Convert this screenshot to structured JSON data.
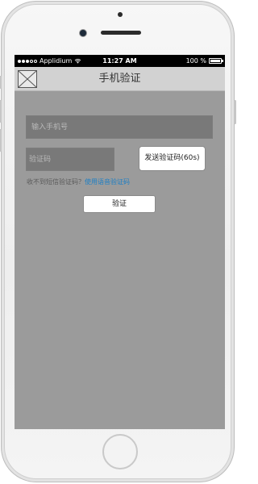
{
  "status_bar": {
    "carrier": "Applidium",
    "time": "11:27 AM",
    "battery": "100 %",
    "signal_icon": "signal-dots-icon",
    "wifi_icon": "wifi-icon",
    "battery_icon": "battery-icon"
  },
  "nav": {
    "title": "手机验证",
    "back_icon": "image-placeholder-icon"
  },
  "form": {
    "phone_placeholder": "输入手机号",
    "phone_value": "",
    "code_placeholder": "验证码",
    "code_value": "",
    "send_code_label": "发送验证码(60s)",
    "hint_text": "收不到短信验证码？",
    "voice_link_label": "使用语音验证码",
    "verify_label": "验证"
  },
  "colors": {
    "screen_bg": "#9b9b9b",
    "nav_bg": "#d2d2d2",
    "input_bg": "#797979",
    "link": "#1e7fc4"
  }
}
